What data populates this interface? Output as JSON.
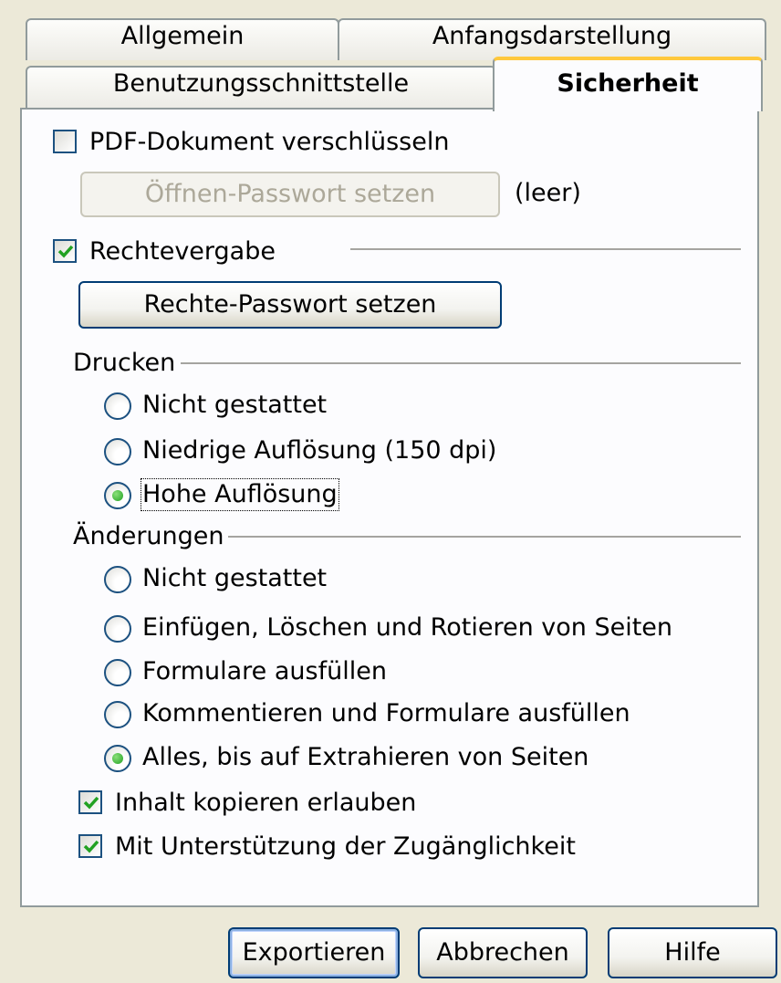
{
  "tabs": {
    "row1": [
      "Allgemein",
      "Anfangsdarstellung"
    ],
    "row2": [
      "Benutzungsschnittstelle",
      "Sicherheit"
    ],
    "active": "Sicherheit"
  },
  "encrypt": {
    "checkbox_label": "PDF-Dokument verschlüsseln",
    "checked": false,
    "open_password_button": "Öffnen-Passwort setzen",
    "open_password_status": "(leer)"
  },
  "permissions": {
    "checkbox_label": "Rechtevergabe",
    "checked": true,
    "permission_password_button": "Rechte-Passwort setzen"
  },
  "printing": {
    "heading": "Drucken",
    "options": [
      "Nicht gestattet",
      "Niedrige Auflösung (150 dpi)",
      "Hohe Auflösung"
    ],
    "selected": "Hohe Auflösung"
  },
  "changes": {
    "heading": "Änderungen",
    "options": [
      "Nicht gestattet",
      "Einfügen, Löschen und Rotieren von Seiten",
      "Formulare ausfüllen",
      "Kommentieren und Formulare ausfüllen",
      "Alles, bis auf Extrahieren von Seiten"
    ],
    "selected": "Alles, bis auf Extrahieren von Seiten"
  },
  "content": {
    "copy_label": "Inhalt kopieren erlauben",
    "copy_checked": true,
    "accessibility_label": "Mit Unterstützung der Zugänglichkeit",
    "accessibility_checked": true
  },
  "footer": {
    "export_button": "Exportieren",
    "cancel_button": "Abbrechen",
    "help_button": "Hilfe"
  },
  "colors": {
    "dialog_bg": "#ECE9D8",
    "panel_bg": "#FCFCFE",
    "active_tab_accent": "#FFC83C",
    "control_border": "#1C5180",
    "check_green": "#21A121"
  }
}
